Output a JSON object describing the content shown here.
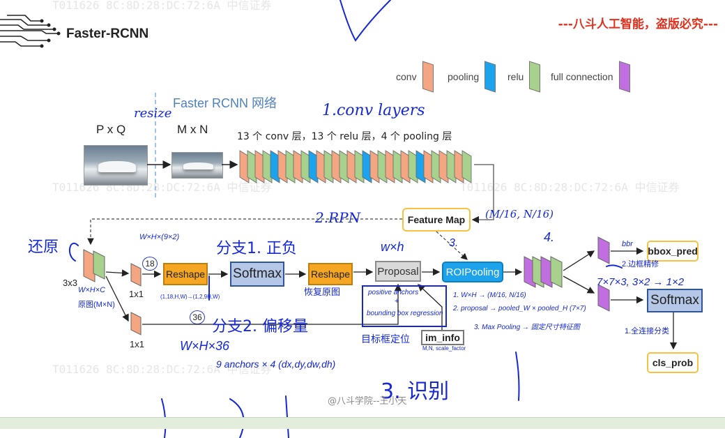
{
  "header": {
    "title": "Faster-RCNN",
    "watermark": "---八斗人工智能，盗版必究---",
    "faint_watermark_1": "T011626   8C:8D:28:DC:72:6A   中信证券",
    "faint_watermark_2": "T011626   8C:8D:28:DC:72:6A   中信证券"
  },
  "legend": {
    "conv": "conv",
    "pooling": "pooling",
    "relu": "relu",
    "fc": "full connection",
    "colors": {
      "conv": "#f4a582",
      "pooling": "#1ca3ec",
      "relu": "#a9d18e",
      "fc": "#c06ee0"
    }
  },
  "network": {
    "title": "Faster RCNN 网络",
    "input_label": "P x Q",
    "resized_label": "M x N",
    "layers_caption": "13 个 conv 层，13 个 relu 层，4 个 pooling 层"
  },
  "rpn": {
    "feature_map": "Feature Map",
    "conv3x3": "3x3",
    "conv1x1_a": "1x1",
    "conv1x1_b": "1x1",
    "n18": "18",
    "n36": "36",
    "reshape_1": "Reshape",
    "softmax_1": "Softmax",
    "reshape_2": "Reshape",
    "proposal": "Proposal",
    "roi": "ROIPooling",
    "im_info": "im_info"
  },
  "head": {
    "bbox_pred": "bbox_pred",
    "softmax": "Softmax",
    "cls_prob": "cls_prob"
  },
  "annotations": {
    "resize": "resize",
    "conv_layers": "1.conv layers",
    "rpn": "2.RPN",
    "m16": "(M/16, N/16)",
    "step3": "3.",
    "step4": "4.",
    "restore": "还原",
    "whc": "W×H×C",
    "orig_mn": "原图(M×N)",
    "wxh9x2": "W×H×(9×2)",
    "branch1": "分支1. 正负",
    "wxh": "w×h",
    "restore_shape": "恢复原图",
    "shape_note": "(1,18,H,W)→(1,2,9H,W)",
    "branch2": "分支2. 偏移量",
    "wxhx36": "W×H×36",
    "anchors": "9 anchors × 4 (dx,dy,dw,dh)",
    "positive_anchors": "positive anchors",
    "plus": "+",
    "bbox_reg": "bounding box regression",
    "target_box": "目标框定位",
    "bbr": "bbr",
    "bbr_note": "2.边框精修",
    "dims": "7×7×3, 3×2 → 1×2",
    "roi_notes_1": "1. W×H → (M/16, N/16)",
    "roi_notes_2": "2. proposal → pooled_W × pooled_H (7×7)",
    "roi_notes_3": "3. Max Pooling → 固定尺寸特征图",
    "fc_note": "1.全连接分类",
    "bottom_text": "3.  识别",
    "im_info_note": "M,N, scale_factor",
    "credit": "@八斗学院--王小天"
  }
}
